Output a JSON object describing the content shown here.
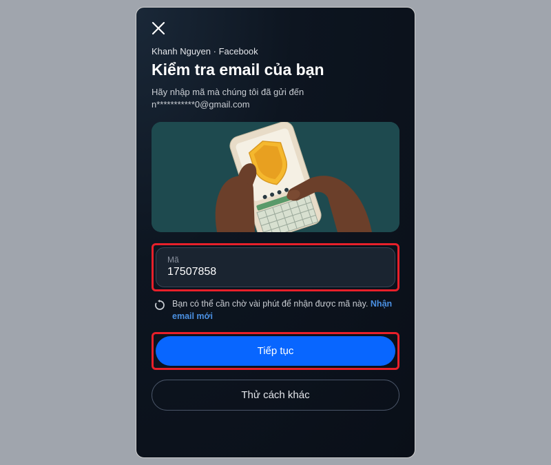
{
  "header": {
    "breadcrumb": "Khanh Nguyen · Facebook",
    "title": "Kiểm tra email của bạn",
    "subtitle_line1": "Hãy nhập mã mà chúng tôi đã gửi đến",
    "subtitle_line2": "n***********0@gmail.com"
  },
  "code_input": {
    "label": "Mã",
    "value": "17507858"
  },
  "wait": {
    "text": "Bạn có thể cần chờ vài phút để nhận được mã này. ",
    "link": "Nhận email mới"
  },
  "buttons": {
    "primary": "Tiếp tục",
    "secondary": "Thử cách khác"
  },
  "colors": {
    "primary": "#0866ff",
    "highlight": "#e8202a"
  }
}
